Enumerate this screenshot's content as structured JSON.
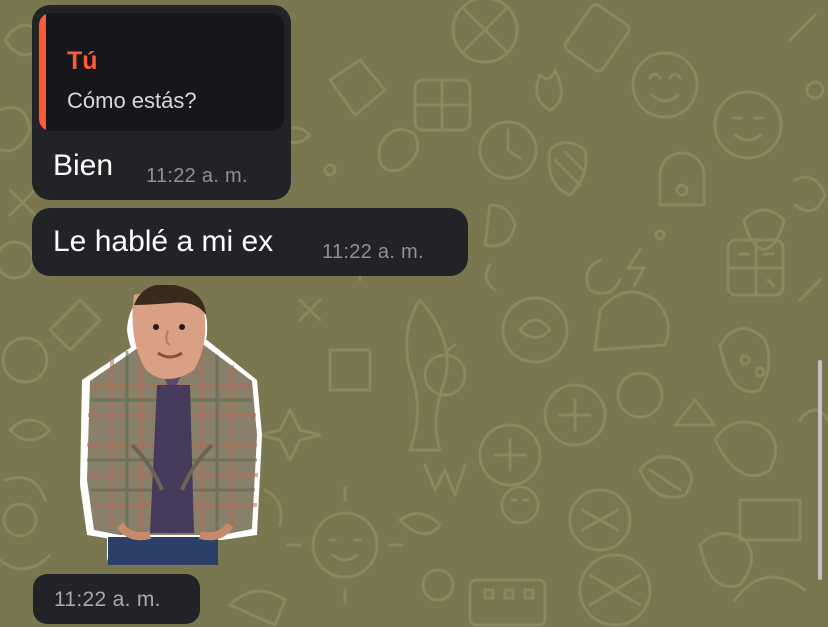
{
  "colors": {
    "wallpaper": "#7a7650",
    "bubble": "#222326",
    "reply_accent": "#ff5a36",
    "timestamp": "#8f9095"
  },
  "messages": [
    {
      "reply": {
        "author": "Tú",
        "text": "Cómo estás?"
      },
      "text": "Bien",
      "time": "11:22 a. m."
    },
    {
      "text": "Le hablé a mi ex",
      "time": "11:22 a. m."
    },
    {
      "sticker": "man-in-plaid-shirt-sticker",
      "time": "11:22 a. m."
    }
  ]
}
